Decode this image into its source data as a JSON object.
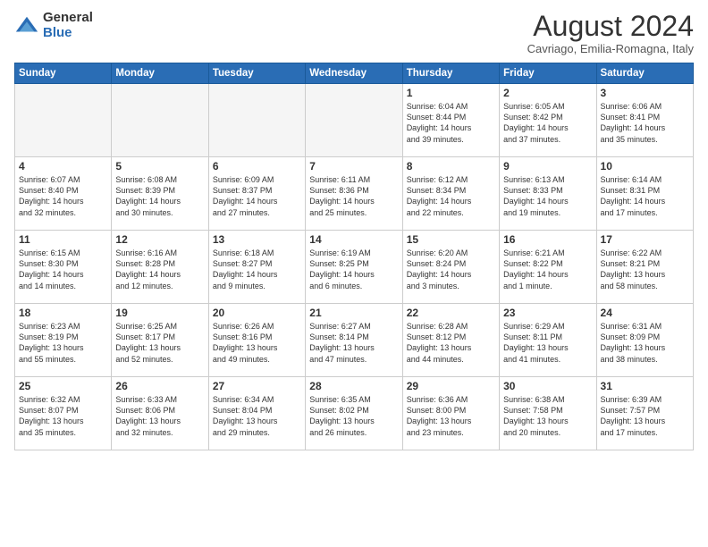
{
  "header": {
    "logo_general": "General",
    "logo_blue": "Blue",
    "month_year": "August 2024",
    "location": "Cavriago, Emilia-Romagna, Italy"
  },
  "weekdays": [
    "Sunday",
    "Monday",
    "Tuesday",
    "Wednesday",
    "Thursday",
    "Friday",
    "Saturday"
  ],
  "weeks": [
    [
      {
        "day": "",
        "info": ""
      },
      {
        "day": "",
        "info": ""
      },
      {
        "day": "",
        "info": ""
      },
      {
        "day": "",
        "info": ""
      },
      {
        "day": "1",
        "info": "Sunrise: 6:04 AM\nSunset: 8:44 PM\nDaylight: 14 hours\nand 39 minutes."
      },
      {
        "day": "2",
        "info": "Sunrise: 6:05 AM\nSunset: 8:42 PM\nDaylight: 14 hours\nand 37 minutes."
      },
      {
        "day": "3",
        "info": "Sunrise: 6:06 AM\nSunset: 8:41 PM\nDaylight: 14 hours\nand 35 minutes."
      }
    ],
    [
      {
        "day": "4",
        "info": "Sunrise: 6:07 AM\nSunset: 8:40 PM\nDaylight: 14 hours\nand 32 minutes."
      },
      {
        "day": "5",
        "info": "Sunrise: 6:08 AM\nSunset: 8:39 PM\nDaylight: 14 hours\nand 30 minutes."
      },
      {
        "day": "6",
        "info": "Sunrise: 6:09 AM\nSunset: 8:37 PM\nDaylight: 14 hours\nand 27 minutes."
      },
      {
        "day": "7",
        "info": "Sunrise: 6:11 AM\nSunset: 8:36 PM\nDaylight: 14 hours\nand 25 minutes."
      },
      {
        "day": "8",
        "info": "Sunrise: 6:12 AM\nSunset: 8:34 PM\nDaylight: 14 hours\nand 22 minutes."
      },
      {
        "day": "9",
        "info": "Sunrise: 6:13 AM\nSunset: 8:33 PM\nDaylight: 14 hours\nand 19 minutes."
      },
      {
        "day": "10",
        "info": "Sunrise: 6:14 AM\nSunset: 8:31 PM\nDaylight: 14 hours\nand 17 minutes."
      }
    ],
    [
      {
        "day": "11",
        "info": "Sunrise: 6:15 AM\nSunset: 8:30 PM\nDaylight: 14 hours\nand 14 minutes."
      },
      {
        "day": "12",
        "info": "Sunrise: 6:16 AM\nSunset: 8:28 PM\nDaylight: 14 hours\nand 12 minutes."
      },
      {
        "day": "13",
        "info": "Sunrise: 6:18 AM\nSunset: 8:27 PM\nDaylight: 14 hours\nand 9 minutes."
      },
      {
        "day": "14",
        "info": "Sunrise: 6:19 AM\nSunset: 8:25 PM\nDaylight: 14 hours\nand 6 minutes."
      },
      {
        "day": "15",
        "info": "Sunrise: 6:20 AM\nSunset: 8:24 PM\nDaylight: 14 hours\nand 3 minutes."
      },
      {
        "day": "16",
        "info": "Sunrise: 6:21 AM\nSunset: 8:22 PM\nDaylight: 14 hours\nand 1 minute."
      },
      {
        "day": "17",
        "info": "Sunrise: 6:22 AM\nSunset: 8:21 PM\nDaylight: 13 hours\nand 58 minutes."
      }
    ],
    [
      {
        "day": "18",
        "info": "Sunrise: 6:23 AM\nSunset: 8:19 PM\nDaylight: 13 hours\nand 55 minutes."
      },
      {
        "day": "19",
        "info": "Sunrise: 6:25 AM\nSunset: 8:17 PM\nDaylight: 13 hours\nand 52 minutes."
      },
      {
        "day": "20",
        "info": "Sunrise: 6:26 AM\nSunset: 8:16 PM\nDaylight: 13 hours\nand 49 minutes."
      },
      {
        "day": "21",
        "info": "Sunrise: 6:27 AM\nSunset: 8:14 PM\nDaylight: 13 hours\nand 47 minutes."
      },
      {
        "day": "22",
        "info": "Sunrise: 6:28 AM\nSunset: 8:12 PM\nDaylight: 13 hours\nand 44 minutes."
      },
      {
        "day": "23",
        "info": "Sunrise: 6:29 AM\nSunset: 8:11 PM\nDaylight: 13 hours\nand 41 minutes."
      },
      {
        "day": "24",
        "info": "Sunrise: 6:31 AM\nSunset: 8:09 PM\nDaylight: 13 hours\nand 38 minutes."
      }
    ],
    [
      {
        "day": "25",
        "info": "Sunrise: 6:32 AM\nSunset: 8:07 PM\nDaylight: 13 hours\nand 35 minutes."
      },
      {
        "day": "26",
        "info": "Sunrise: 6:33 AM\nSunset: 8:06 PM\nDaylight: 13 hours\nand 32 minutes."
      },
      {
        "day": "27",
        "info": "Sunrise: 6:34 AM\nSunset: 8:04 PM\nDaylight: 13 hours\nand 29 minutes."
      },
      {
        "day": "28",
        "info": "Sunrise: 6:35 AM\nSunset: 8:02 PM\nDaylight: 13 hours\nand 26 minutes."
      },
      {
        "day": "29",
        "info": "Sunrise: 6:36 AM\nSunset: 8:00 PM\nDaylight: 13 hours\nand 23 minutes."
      },
      {
        "day": "30",
        "info": "Sunrise: 6:38 AM\nSunset: 7:58 PM\nDaylight: 13 hours\nand 20 minutes."
      },
      {
        "day": "31",
        "info": "Sunrise: 6:39 AM\nSunset: 7:57 PM\nDaylight: 13 hours\nand 17 minutes."
      }
    ]
  ]
}
